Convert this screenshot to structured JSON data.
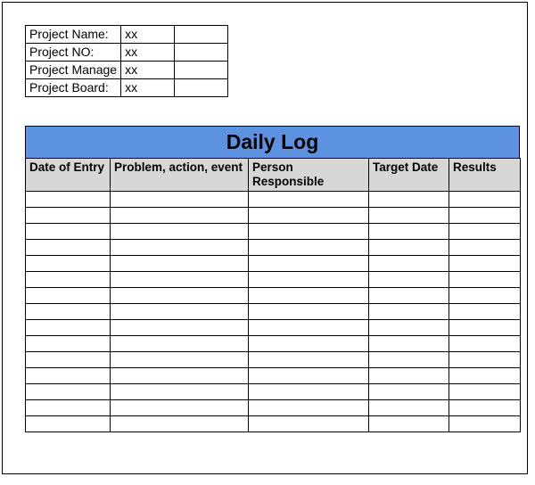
{
  "info": {
    "rows": [
      {
        "label": "Project Name:",
        "value": "xx",
        "extra": ""
      },
      {
        "label": "Project NO:",
        "value": "xx",
        "extra": ""
      },
      {
        "label": "Project Manage",
        "value": "xx",
        "extra": ""
      },
      {
        "label": "Project Board:",
        "value": "xx",
        "extra": ""
      }
    ]
  },
  "log": {
    "title": "Daily Log",
    "columns": [
      "Date of Entry",
      "Problem, action, event",
      "Person Responsible",
      "Target Date",
      "Results"
    ],
    "row_count": 15
  }
}
